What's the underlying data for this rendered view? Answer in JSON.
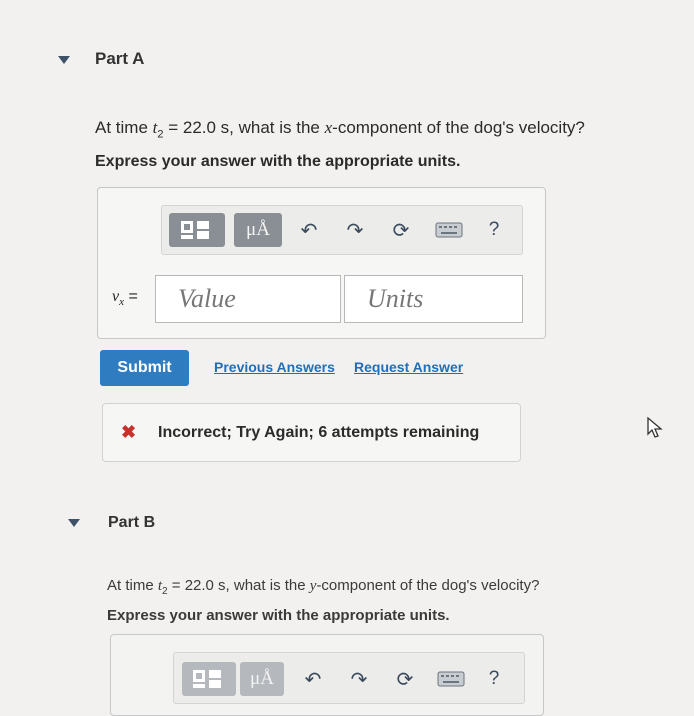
{
  "part_a": {
    "title": "Part A",
    "question_pre": "At time ",
    "time_var": "t",
    "time_sub": "2",
    "question_mid": " = 22.0 s, what is the ",
    "axis": "x",
    "question_post": "-component of the dog's velocity?",
    "instruction": "Express your answer with the appropriate units.",
    "var_label": "v",
    "var_sub": "x",
    "equals": "=",
    "value_placeholder": "Value",
    "units_placeholder": "Units",
    "submit": "Submit",
    "previous_answers": "Previous Answers",
    "request_answer": "Request Answer",
    "feedback": "Incorrect; Try Again; 6 attempts remaining",
    "feedback_icon": "✖"
  },
  "part_b": {
    "title": "Part B",
    "question_pre": "At time ",
    "time_var": "t",
    "time_sub": "2",
    "question_mid": " = 22.0 s, what is the ",
    "axis": "y",
    "question_post": "-component of the dog's velocity?",
    "instruction": "Express your answer with the appropriate units."
  },
  "toolbar": {
    "mu_label": "μÅ",
    "help": "?"
  },
  "colors": {
    "submit_bg": "#2f7cc0",
    "link": "#2070b8",
    "error": "#c8312b"
  }
}
